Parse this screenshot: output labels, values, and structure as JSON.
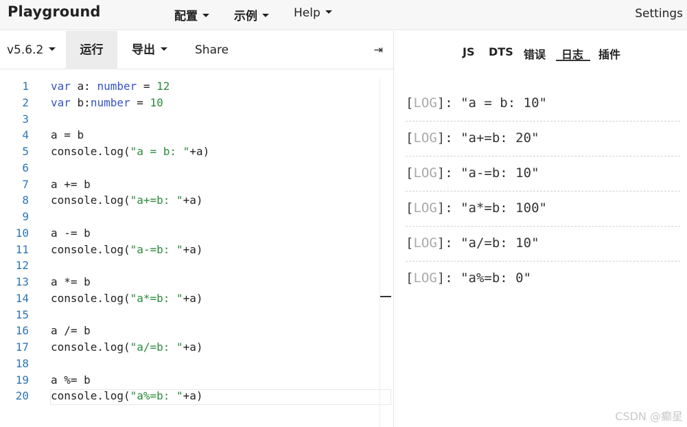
{
  "nav": {
    "brand": "Playground",
    "menu": [
      {
        "label": "配置"
      },
      {
        "label": "示例"
      },
      {
        "label": "Help"
      }
    ],
    "settings": "Settings"
  },
  "toolbar": {
    "version": "v5.6.2",
    "run": "运行",
    "export": "导出",
    "share": "Share",
    "collapse_icon": "⇥"
  },
  "editor": {
    "lines": [
      {
        "n": "1"
      },
      {
        "n": "2"
      },
      {
        "n": "3"
      },
      {
        "n": "4"
      },
      {
        "n": "5"
      },
      {
        "n": "6"
      },
      {
        "n": "7"
      },
      {
        "n": "8"
      },
      {
        "n": "9"
      },
      {
        "n": "10"
      },
      {
        "n": "11"
      },
      {
        "n": "12"
      },
      {
        "n": "13"
      },
      {
        "n": "14"
      },
      {
        "n": "15"
      },
      {
        "n": "16"
      },
      {
        "n": "17"
      },
      {
        "n": "18"
      },
      {
        "n": "19"
      },
      {
        "n": "20"
      }
    ],
    "tokens": {
      "l1": {
        "kw": "var",
        "rest1": " a: ",
        "ty": "number",
        "rest2": " = ",
        "num": "12"
      },
      "l2": {
        "kw": "var",
        "rest1": " b:",
        "ty": "number",
        "rest2": " = ",
        "num": "10"
      },
      "l4": "a = b",
      "l5": {
        "pre": "console.log(",
        "str": "\"a = b: \"",
        "post": "+a)"
      },
      "l7": "a += b",
      "l8": {
        "pre": "console.log(",
        "str": "\"a+=b: \"",
        "post": "+a)"
      },
      "l10": "a -= b",
      "l11": {
        "pre": "console.log(",
        "str": "\"a-=b: \"",
        "post": "+a)"
      },
      "l13": "a *= b",
      "l14": {
        "pre": "console.log(",
        "str": "\"a*=b: \"",
        "post": "+a)"
      },
      "l16": "a /= b",
      "l17": {
        "pre": "console.log(",
        "str": "\"a/=b: \"",
        "post": "+a)"
      },
      "l19": "a %= b",
      "l20": {
        "pre": "console.log(",
        "str": "\"a%=b: \"",
        "post": "+a)"
      }
    }
  },
  "panel": {
    "tabs": [
      "JS",
      "DTS",
      "错误",
      "日志",
      "插件"
    ],
    "active_tab": "日志",
    "logs": [
      {
        "open": "[",
        "tag": "LOG",
        "close": "]",
        "msg": ": \"a = b: 10\""
      },
      {
        "open": "[",
        "tag": "LOG",
        "close": "]",
        "msg": ": \"a+=b: 20\""
      },
      {
        "open": "[",
        "tag": "LOG",
        "close": "]",
        "msg": ": \"a-=b: 10\""
      },
      {
        "open": "[",
        "tag": "LOG",
        "close": "]",
        "msg": ": \"a*=b: 100\""
      },
      {
        "open": "[",
        "tag": "LOG",
        "close": "]",
        "msg": ": \"a/=b: 10\""
      },
      {
        "open": "[",
        "tag": "LOG",
        "close": "]",
        "msg": ": \"a%=b: 0\""
      }
    ]
  },
  "watermark": "CSDN @癫星"
}
